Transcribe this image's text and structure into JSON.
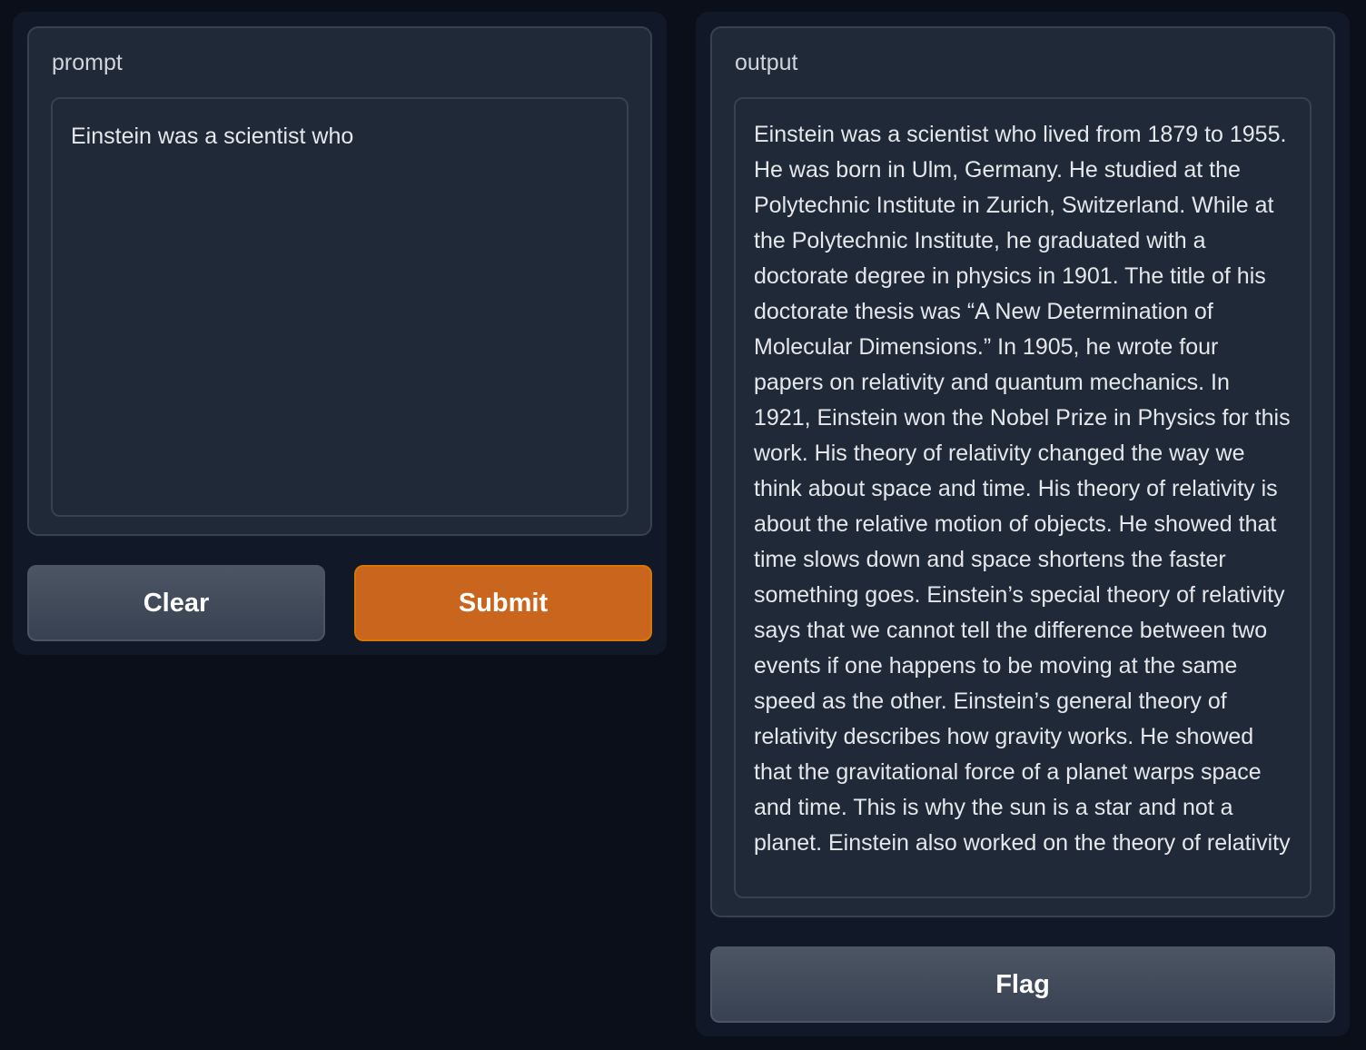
{
  "input_panel": {
    "label": "prompt",
    "value": "Einstein was a scientist who"
  },
  "output_panel": {
    "label": "output",
    "value": "Einstein was a scientist who lived from 1879 to 1955. He was born in Ulm, Germany. He studied at the Polytechnic Institute in Zurich, Switzerland. While at the Polytechnic Institute, he graduated with a doctorate degree in physics in 1901. The title of his doctorate thesis was “A New Determination of Molecular Dimensions.” In 1905, he wrote four papers on relativity and quantum mechanics. In 1921, Einstein won the Nobel Prize in Physics for this work. His theory of relativity changed the way we think about space and time. His theory of relativity is about the relative motion of objects. He showed that time slows down and space shortens the faster something goes. Einstein’s special theory of relativity says that we cannot tell the difference between two events if one happens to be moving at the same speed as the other. Einstein’s general theory of relativity describes how gravity works. He showed that the gravitational force of a planet warps space and time. This is why the sun is a star and not a planet. Einstein also worked on the theory of relativity"
  },
  "buttons": {
    "clear": "Clear",
    "submit": "Submit",
    "flag": "Flag"
  },
  "colors": {
    "background": "#0b0f19",
    "panel": "#1f2937",
    "primary_button": "#c9651c",
    "secondary_button": "#4b5563"
  }
}
